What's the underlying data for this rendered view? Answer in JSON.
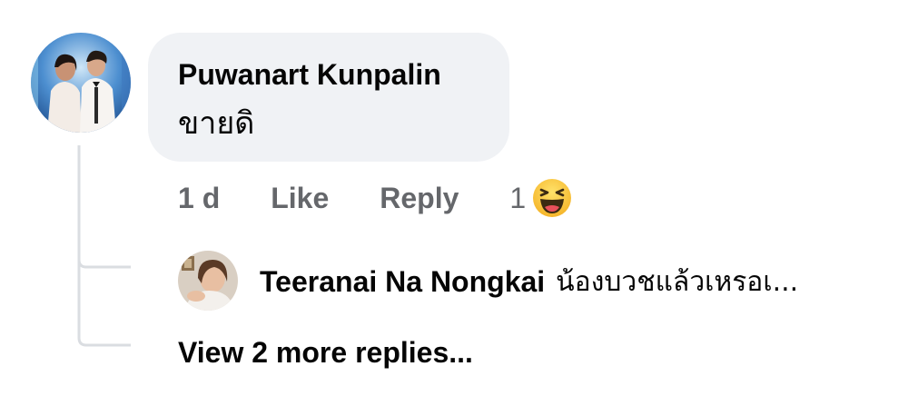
{
  "comment": {
    "author": "Puwanart Kunpalin",
    "text": "ขายดิ",
    "time": "1 d",
    "like_label": "Like",
    "reply_label": "Reply",
    "reaction_count": "1",
    "reaction_icon": "laughing-emoji-icon"
  },
  "reply": {
    "author": "Teeranai Na Nongkai",
    "text": "น้องบวชแล้วเหรอเ..."
  },
  "view_more_label": "View 2 more replies...",
  "colors": {
    "bubble_bg": "#f0f2f5",
    "muted_text": "#65676b",
    "primary_text": "#050505",
    "thread_line": "#dadde1"
  }
}
